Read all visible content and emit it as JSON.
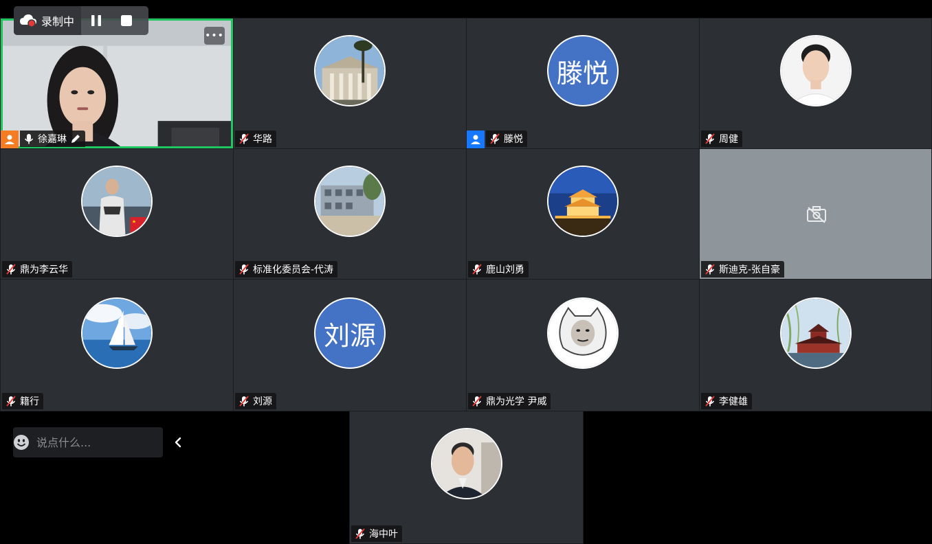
{
  "recording": {
    "label": "录制中"
  },
  "chat": {
    "placeholder": "说点什么..."
  },
  "participants": [
    {
      "name": "徐嘉琳"
    },
    {
      "name": "华路"
    },
    {
      "name": "滕悦",
      "initials": "滕悦"
    },
    {
      "name": "周健"
    },
    {
      "name": "鼎为李云华"
    },
    {
      "name": "标准化委员会-代涛"
    },
    {
      "name": "鹿山刘勇"
    },
    {
      "name": "斯迪克-张自豪"
    },
    {
      "name": "籍行"
    },
    {
      "name": "刘源",
      "initials": "刘源"
    },
    {
      "name": "鼎为光学 尹威"
    },
    {
      "name": "李健雄"
    },
    {
      "name": "海中叶"
    }
  ],
  "colors": {
    "tile_bg": "#2c2f33",
    "active_border": "#1ec760",
    "avatar_text_bg": "#4472c4",
    "cam_off_bg": "#8e959b"
  }
}
